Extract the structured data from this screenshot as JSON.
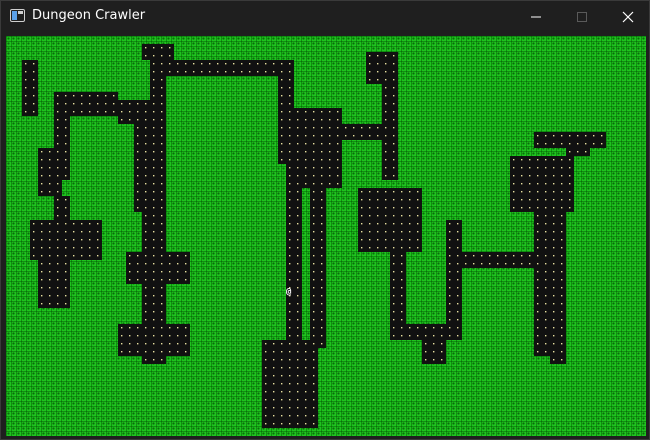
{
  "window": {
    "title": "Dungeon Crawler",
    "icon": "app-window-icon"
  },
  "controls": {
    "minimize_icon": "minimize-icon",
    "maximize_icon": "maximize-icon",
    "close_icon": "close-icon"
  },
  "game": {
    "player_glyph": "@",
    "colors": {
      "floor": "#1ec31e",
      "wall": "#111111",
      "dot": "#e8e0a0",
      "player": "#ffffff"
    }
  }
}
